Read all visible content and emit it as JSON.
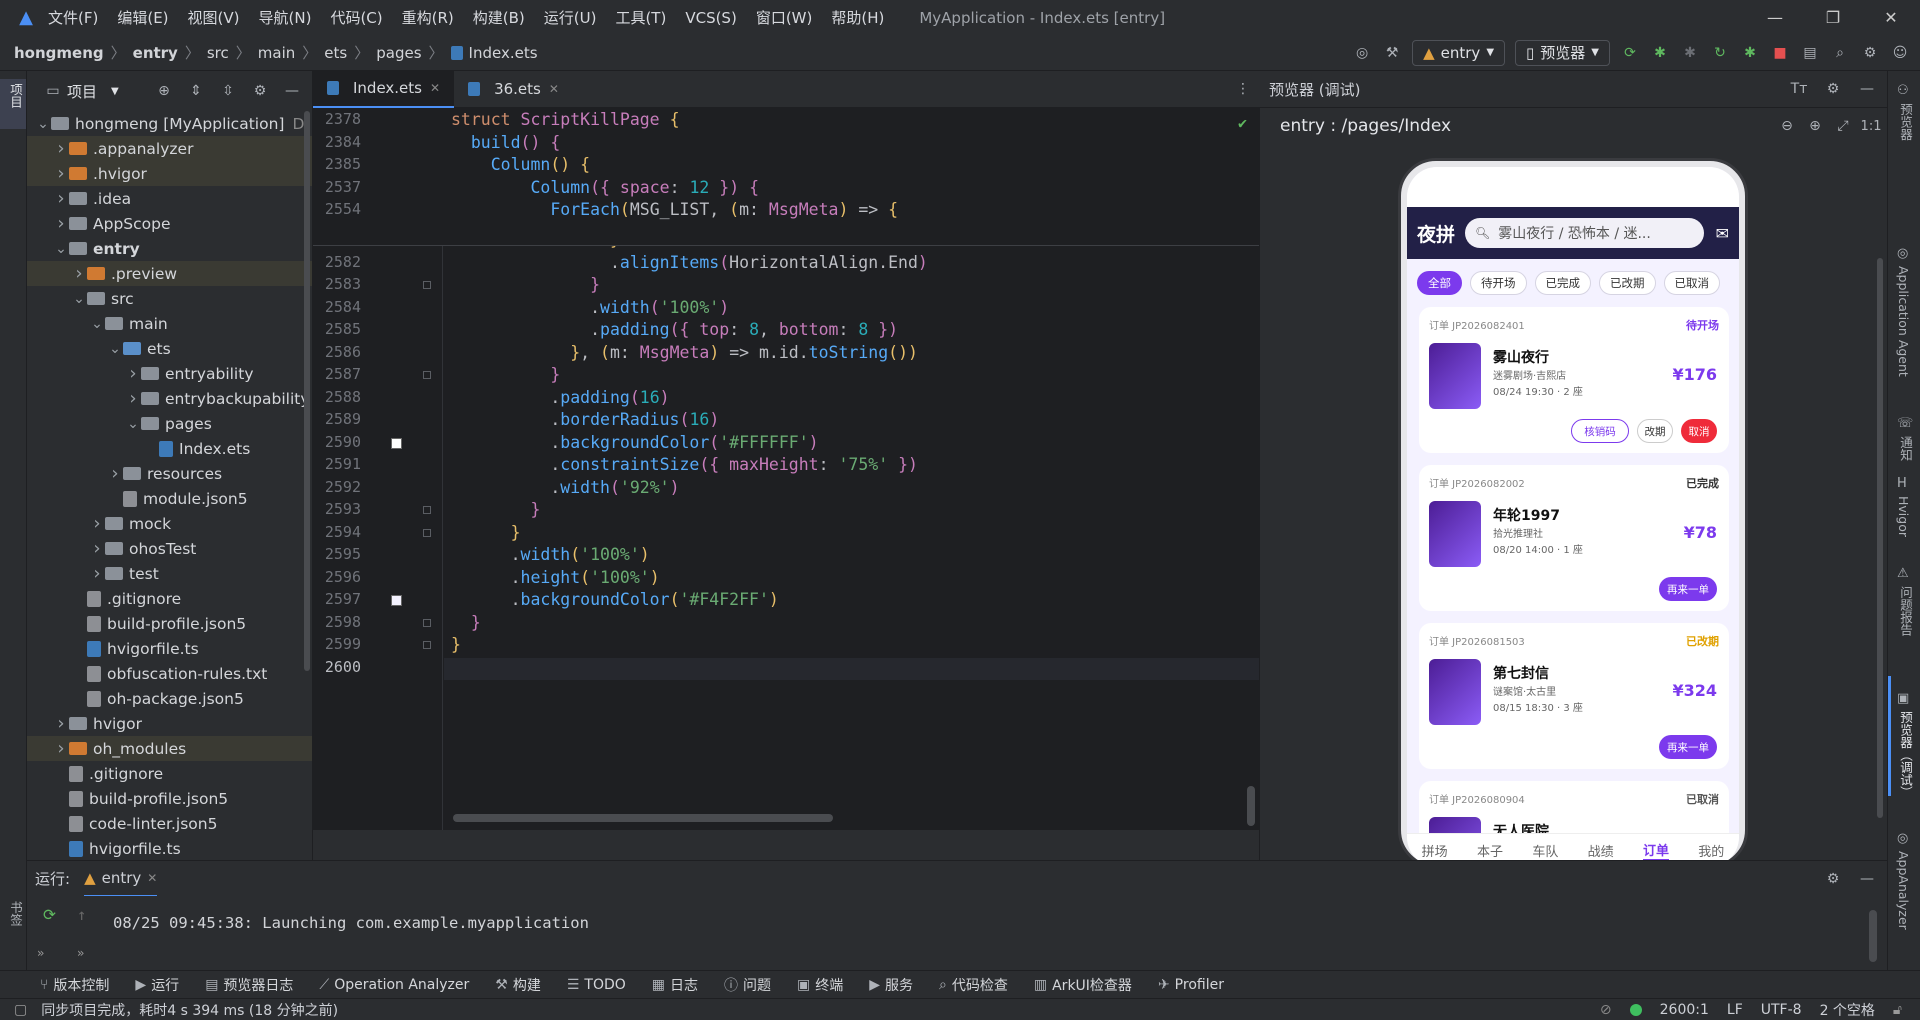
{
  "window": {
    "title": "MyApplication - Index.ets [entry]",
    "menu": [
      "文件(F)",
      "编辑(E)",
      "视图(V)",
      "导航(N)",
      "代码(C)",
      "重构(R)",
      "构建(B)",
      "运行(U)",
      "工具(T)",
      "VCS(S)",
      "窗口(W)",
      "帮助(H)"
    ]
  },
  "breadcrumb": [
    "hongmeng",
    "entry",
    "src",
    "main",
    "ets",
    "pages",
    "Index.ets"
  ],
  "toolbar": {
    "module": "entry",
    "device": "预览器"
  },
  "left_strip": {
    "project": "项目",
    "bookmarks": "书签",
    "structure": "结构"
  },
  "project_panel": {
    "title": "项目",
    "tree": [
      {
        "label": "hongmeng [MyApplication]",
        "suffix": "D:",
        "depth": 0,
        "arrow": "v",
        "type": "folder-gray"
      },
      {
        "label": ".appanalyzer",
        "depth": 1,
        "arrow": ">",
        "type": "folder-orange",
        "hl": true
      },
      {
        "label": ".hvigor",
        "depth": 1,
        "arrow": ">",
        "type": "folder-orange",
        "hl": true
      },
      {
        "label": ".idea",
        "depth": 1,
        "arrow": ">",
        "type": "folder-gray"
      },
      {
        "label": "AppScope",
        "depth": 1,
        "arrow": ">",
        "type": "folder-gray"
      },
      {
        "label": "entry",
        "depth": 1,
        "arrow": "v",
        "type": "folder-gray",
        "bold": true
      },
      {
        "label": ".preview",
        "depth": 2,
        "arrow": ">",
        "type": "folder-orange",
        "hl": true
      },
      {
        "label": "src",
        "depth": 2,
        "arrow": "v",
        "type": "folder-gray"
      },
      {
        "label": "main",
        "depth": 3,
        "arrow": "v",
        "type": "folder-gray"
      },
      {
        "label": "ets",
        "depth": 4,
        "arrow": "v",
        "type": "folder-blue"
      },
      {
        "label": "entryability",
        "depth": 5,
        "arrow": ">",
        "type": "folder-gray"
      },
      {
        "label": "entrybackupability",
        "depth": 5,
        "arrow": ">",
        "type": "folder-gray"
      },
      {
        "label": "pages",
        "depth": 5,
        "arrow": "v",
        "type": "folder-gray"
      },
      {
        "label": "Index.ets",
        "depth": 6,
        "arrow": "",
        "type": "file-ets"
      },
      {
        "label": "resources",
        "depth": 4,
        "arrow": ">",
        "type": "folder-gray"
      },
      {
        "label": "module.json5",
        "depth": 4,
        "arrow": "",
        "type": "file-json"
      },
      {
        "label": "mock",
        "depth": 3,
        "arrow": ">",
        "type": "folder-gray"
      },
      {
        "label": "ohosTest",
        "depth": 3,
        "arrow": ">",
        "type": "folder-gray"
      },
      {
        "label": "test",
        "depth": 3,
        "arrow": ">",
        "type": "folder-gray"
      },
      {
        "label": ".gitignore",
        "depth": 2,
        "arrow": "",
        "type": "file-json"
      },
      {
        "label": "build-profile.json5",
        "depth": 2,
        "arrow": "",
        "type": "file-json"
      },
      {
        "label": "hvigorfile.ts",
        "depth": 2,
        "arrow": "",
        "type": "file-ts"
      },
      {
        "label": "obfuscation-rules.txt",
        "depth": 2,
        "arrow": "",
        "type": "file-json"
      },
      {
        "label": "oh-package.json5",
        "depth": 2,
        "arrow": "",
        "type": "file-json"
      },
      {
        "label": "hvigor",
        "depth": 1,
        "arrow": ">",
        "type": "folder-gray"
      },
      {
        "label": "oh_modules",
        "depth": 1,
        "arrow": ">",
        "type": "folder-orange",
        "hl": true
      },
      {
        "label": ".gitignore",
        "depth": 1,
        "arrow": "",
        "type": "file-json"
      },
      {
        "label": "build-profile.json5",
        "depth": 1,
        "arrow": "",
        "type": "file-json"
      },
      {
        "label": "code-linter.json5",
        "depth": 1,
        "arrow": "",
        "type": "file-json"
      },
      {
        "label": "hvigorfile.ts",
        "depth": 1,
        "arrow": "",
        "type": "file-ts"
      }
    ]
  },
  "editor": {
    "tabs": [
      {
        "label": "Index.ets",
        "active": true
      },
      {
        "label": "36.ets",
        "active": false
      }
    ],
    "sticky_lines": [
      {
        "n": "2378",
        "html": "<span class='kw'>struct</span> <span class='ty'>ScriptKillPage</span> <span class='br'>{</span>"
      },
      {
        "n": "2384",
        "html": "  <span class='fn'>build</span><span class='br2'>()</span> <span class='br2'>{</span>"
      },
      {
        "n": "2385",
        "html": "    <span class='fn'>Column</span><span class='br'>()</span> <span class='br'>{</span>"
      },
      {
        "n": "2537",
        "html": "        <span class='fn'>Column</span><span class='br2'>({</span> <span class='pk'>space</span>: <span class='num'>12</span> <span class='br2'>})</span> <span class='br2'>{</span>"
      },
      {
        "n": "2554",
        "html": "          <span class='fn'>ForEach</span><span class='br'>(</span>MSG_LIST, <span class='br'>(</span>m: <span class='ty'>MsgMeta</span><span class='br'>)</span> => <span class='br'>{</span>"
      }
    ],
    "lines": [
      {
        "n": "2581",
        "html": "                <span class='br'>}</span>"
      },
      {
        "n": "2582",
        "html": "                .<span class='fn'>alignItems</span><span class='br2'>(</span>HorizontalAlign.End<span class='br2'>)</span>"
      },
      {
        "n": "2583",
        "html": "              <span class='br2'>}</span>"
      },
      {
        "n": "2584",
        "html": "              .<span class='fn'>width</span><span class='br2'>(</span><span class='str'>'100%'</span><span class='br2'>)</span>"
      },
      {
        "n": "2585",
        "html": "              .<span class='fn'>padding</span><span class='br2'>({</span> <span class='pk'>top</span>: <span class='num'>8</span>, <span class='pk'>bottom</span>: <span class='num'>8</span> <span class='br2'>})</span>"
      },
      {
        "n": "2586",
        "html": "            <span class='br'>}</span>, <span class='br'>(</span>m: <span class='ty'>MsgMeta</span><span class='br'>)</span> => m.id.<span class='fn'>toString</span><span class='br'>())</span>"
      },
      {
        "n": "2587",
        "html": "          <span class='br2'>}</span>"
      },
      {
        "n": "2588",
        "html": "          .<span class='fn'>padding</span><span class='br2'>(</span><span class='num'>16</span><span class='br2'>)</span>"
      },
      {
        "n": "2589",
        "html": "          .<span class='fn'>borderRadius</span><span class='br2'>(</span><span class='num'>16</span><span class='br2'>)</span>"
      },
      {
        "n": "2590",
        "html": "          .<span class='fn'>backgroundColor</span><span class='br2'>(</span><span class='str'>'#FFFFFF'</span><span class='br2'>)</span>",
        "swatch": "#FFFFFF"
      },
      {
        "n": "2591",
        "html": "          .<span class='fn'>constraintSize</span><span class='br2'>({</span> <span class='pk'>maxHeight</span>: <span class='str'>'75%'</span> <span class='br2'>})</span>"
      },
      {
        "n": "2592",
        "html": "          .<span class='fn'>width</span><span class='br2'>(</span><span class='str'>'92%'</span><span class='br2'>)</span>"
      },
      {
        "n": "2593",
        "html": "        <span class='br2'>}</span>"
      },
      {
        "n": "2594",
        "html": "      <span class='br'>}</span>"
      },
      {
        "n": "2595",
        "html": "      .<span class='fn'>width</span><span class='br'>(</span><span class='str'>'100%'</span><span class='br'>)</span>"
      },
      {
        "n": "2596",
        "html": "      .<span class='fn'>height</span><span class='br'>(</span><span class='str'>'100%'</span><span class='br'>)</span>"
      },
      {
        "n": "2597",
        "html": "      .<span class='fn'>backgroundColor</span><span class='br'>(</span><span class='str'>'#F4F2FF'</span><span class='br'>)</span>",
        "swatch": "#F4F2FF"
      },
      {
        "n": "2598",
        "html": "  <span class='br2'>}</span>"
      },
      {
        "n": "2599",
        "html": "<span class='br'>}</span>"
      },
      {
        "n": "2600",
        "html": ""
      }
    ]
  },
  "preview": {
    "header": "预览器 (调试)",
    "route": "entry : /pages/Index",
    "app": {
      "title": "夜拼",
      "search_placeholder": "雾山夜行 / 恐怖本 / 迷...",
      "chips": [
        "全部",
        "待开场",
        "已完成",
        "已改期",
        "已取消"
      ],
      "cards": [
        {
          "order": "订单 JP2026082401",
          "status": "待开场",
          "status_color": "#7c3aed",
          "title": "雾山夜行",
          "sub": "迷雾剧场·吉熙店",
          "date": "08/24 19:30 · 2 座",
          "price": "¥176",
          "buttons": [
            {
              "label": "核销码",
              "style": "outline-purple"
            },
            {
              "label": "改期",
              "style": "outline-gray"
            },
            {
              "label": "取消",
              "style": "red"
            }
          ]
        },
        {
          "order": "订单 JP2026082002",
          "status": "已完成",
          "status_color": "#333333",
          "title": "年轮1997",
          "sub": "拾光推理社",
          "date": "08/20 14:00 · 1 座",
          "price": "¥78",
          "buttons": [
            {
              "label": "再来一单",
              "style": "purple"
            }
          ]
        },
        {
          "order": "订单 JP2026081503",
          "status": "已改期",
          "status_color": "#e0a100",
          "title": "第七封信",
          "sub": "谜案馆·太古里",
          "date": "08/15 18:30 · 3 座",
          "price": "¥324",
          "buttons": [
            {
              "label": "再来一单",
              "style": "purple"
            }
          ]
        },
        {
          "order": "订单 JP2026080904",
          "status": "已取消",
          "status_color": "#555555",
          "title": "无人医院",
          "sub": "",
          "date": "",
          "price": "",
          "buttons": []
        }
      ],
      "tabbar": [
        "拼场",
        "本子",
        "车队",
        "战绩",
        "订单",
        "我的"
      ],
      "active_tab": "订单"
    }
  },
  "right_strip": [
    "预览器",
    "Application Agent",
    "通知",
    "Hvigor",
    "问题报告",
    "预览器（调试）",
    "AppAnalyzer",
    "数据库检查器"
  ],
  "run": {
    "label": "运行:",
    "config": "entry",
    "log": "08/25 09:45:38: Launching com.example.myapplication"
  },
  "bottom_tools": [
    "版本控制",
    "运行",
    "预览器日志",
    "Operation Analyzer",
    "构建",
    "TODO",
    "日志",
    "问题",
    "终端",
    "服务",
    "代码检查",
    "ArkUI检查器",
    "Profiler"
  ],
  "status": {
    "message": "同步项目完成，耗时4 s 394 ms (18 分钟之前)",
    "position": "2600:1",
    "line_sep": "LF",
    "encoding": "UTF-8",
    "indent": "2 个空格"
  }
}
